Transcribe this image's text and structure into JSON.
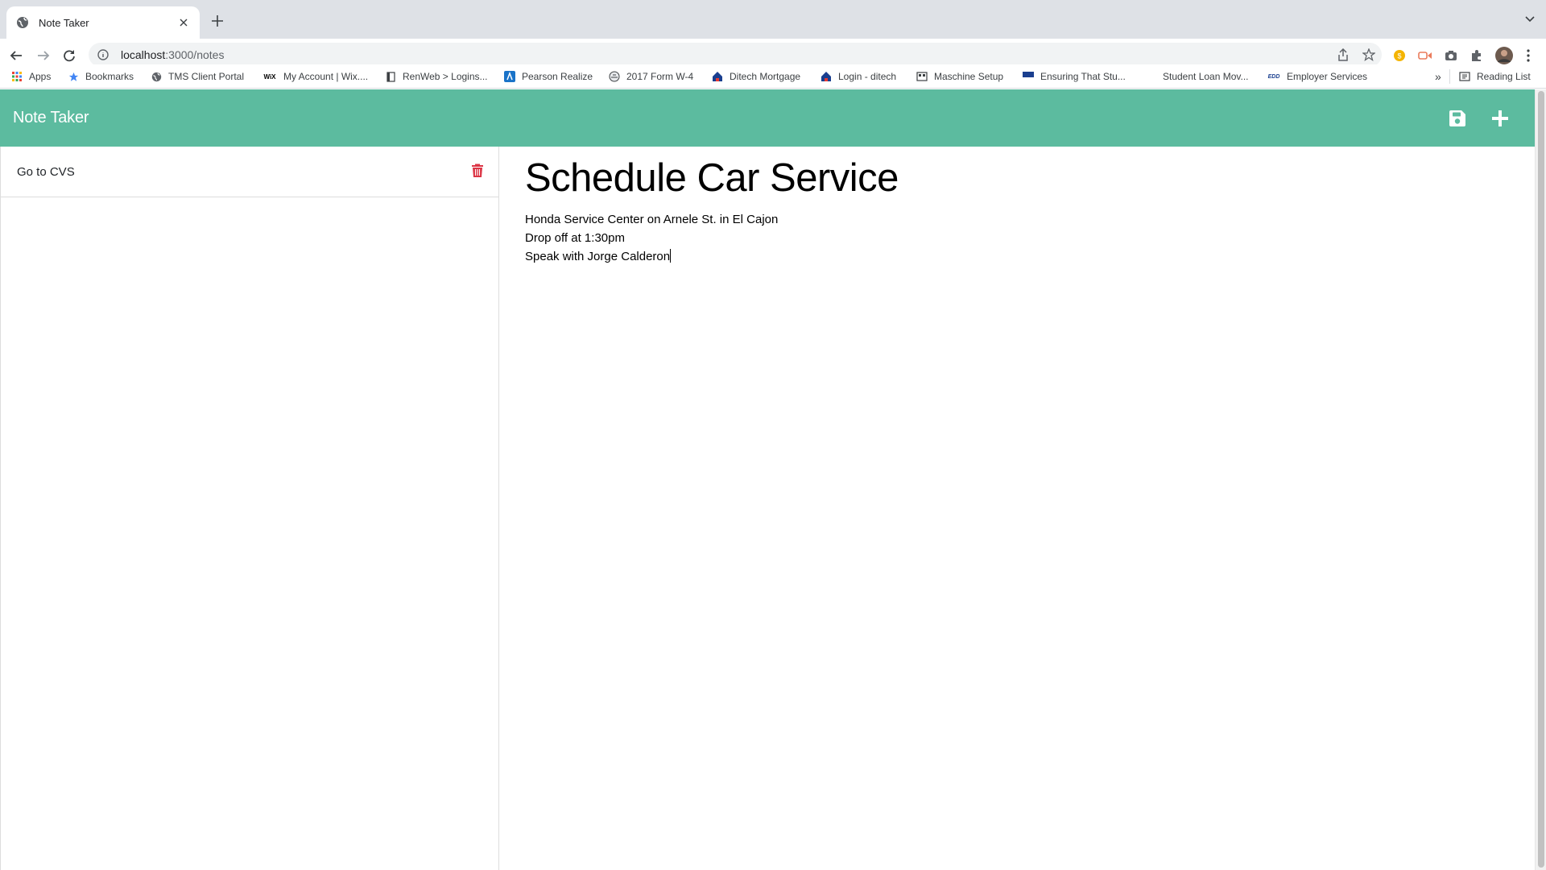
{
  "browser": {
    "tab": {
      "title": "Note Taker"
    },
    "url": {
      "host": "localhost",
      "path": ":3000/notes"
    },
    "bookmarks": [
      {
        "label": "Apps",
        "icon": "apps-grid-icon"
      },
      {
        "label": "Bookmarks",
        "icon": "star-icon"
      },
      {
        "label": "TMS Client Portal",
        "icon": "globe-icon"
      },
      {
        "label": "My Account | Wix....",
        "icon": "wix-icon"
      },
      {
        "label": "RenWeb > Logins...",
        "icon": "page-icon"
      },
      {
        "label": "Pearson Realize",
        "icon": "pearson-icon"
      },
      {
        "label": "2017 Form W-4",
        "icon": "irs-icon"
      },
      {
        "label": "Ditech Mortgage",
        "icon": "house-icon"
      },
      {
        "label": "Login - ditech",
        "icon": "house-icon"
      },
      {
        "label": "Maschine Setup",
        "icon": "device-icon"
      },
      {
        "label": "Ensuring That Stu...",
        "icon": "flag-icon"
      },
      {
        "label": "Student Loan Mov...",
        "icon": "blank-icon"
      },
      {
        "label": "Employer Services",
        "icon": "edd-icon"
      }
    ],
    "more_label": "»",
    "reading_list": "Reading List"
  },
  "app": {
    "title": "Note Taker",
    "notes": [
      {
        "title": "Go to CVS"
      }
    ],
    "active_note": {
      "title": "Schedule Car Service",
      "lines": [
        "Honda Service Center on Arnele St. in El Cajon",
        "Drop off at 1:30pm",
        "Speak with Jorge Calderon"
      ]
    }
  },
  "colors": {
    "header": "#5cbb9f",
    "delete": "#dc3545"
  }
}
